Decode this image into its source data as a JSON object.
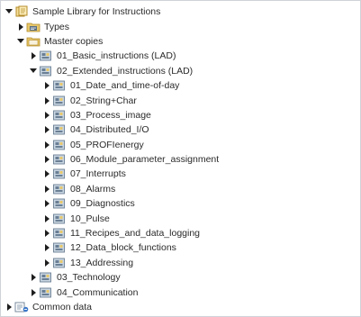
{
  "tree": {
    "root": {
      "label": "Sample Library for Instructions",
      "expanded": true,
      "icon": "library-icon"
    },
    "types": {
      "label": "Types",
      "expanded": false,
      "icon": "types-folder-icon"
    },
    "master_copies": {
      "label": "Master copies",
      "expanded": true,
      "icon": "master-copies-folder-icon"
    },
    "basic": {
      "label": "01_Basic_instructions (LAD)",
      "expanded": false,
      "icon": "group-folder-icon"
    },
    "extended": {
      "label": "02_Extended_instructions (LAD)",
      "expanded": true,
      "icon": "group-folder-icon"
    },
    "extended_children": [
      {
        "label": "01_Date_and_time-of-day"
      },
      {
        "label": "02_String+Char"
      },
      {
        "label": "03_Process_image"
      },
      {
        "label": "04_Distributed_I/O"
      },
      {
        "label": "05_PROFIenergy"
      },
      {
        "label": "06_Module_parameter_assignment"
      },
      {
        "label": "07_Interrupts"
      },
      {
        "label": "08_Alarms"
      },
      {
        "label": "09_Diagnostics"
      },
      {
        "label": "10_Pulse"
      },
      {
        "label": "11_Recipes_and_data_logging"
      },
      {
        "label": "12_Data_block_functions"
      },
      {
        "label": "13_Addressing"
      }
    ],
    "technology": {
      "label": "03_Technology",
      "expanded": false,
      "icon": "group-folder-icon"
    },
    "communication": {
      "label": "04_Communication",
      "expanded": false,
      "icon": "group-folder-icon"
    },
    "common_data": {
      "label": "Common data",
      "expanded": false,
      "icon": "common-data-icon"
    }
  },
  "colors": {
    "arrow": "#1e1e1e",
    "folder": "#e8c86a",
    "folder_dark": "#c9a23f",
    "group_frame": "#6a7f94",
    "group_fill": "#c9d6e2"
  }
}
